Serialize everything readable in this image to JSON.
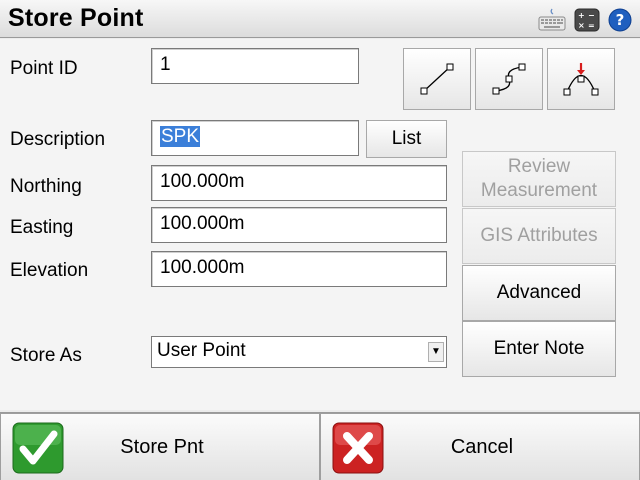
{
  "window": {
    "title": "Store Point"
  },
  "icons": {
    "keyboard": "keyboard-icon",
    "calculator": "calculator-icon",
    "help": "help-icon"
  },
  "form": {
    "point_id": {
      "label": "Point ID",
      "value": "1"
    },
    "description": {
      "label": "Description",
      "value": "SPK",
      "list_button": "List"
    },
    "northing": {
      "label": "Northing",
      "value": "100.000m"
    },
    "easting": {
      "label": "Easting",
      "value": "100.000m"
    },
    "elevation": {
      "label": "Elevation",
      "value": "100.000m"
    },
    "store_as": {
      "label": "Store As",
      "value": "User Point"
    }
  },
  "side_buttons": {
    "review": "Review\nMeasurement",
    "gis": "GIS Attributes",
    "advanced": "Advanced",
    "enter_note": "Enter Note"
  },
  "footer": {
    "store": "Store Pnt",
    "cancel": "Cancel"
  },
  "colors": {
    "accent_select": "#3b7fd9",
    "ok_green": "#2e9a2e",
    "cancel_red": "#cc2222",
    "help_blue": "#1f5fbf"
  }
}
